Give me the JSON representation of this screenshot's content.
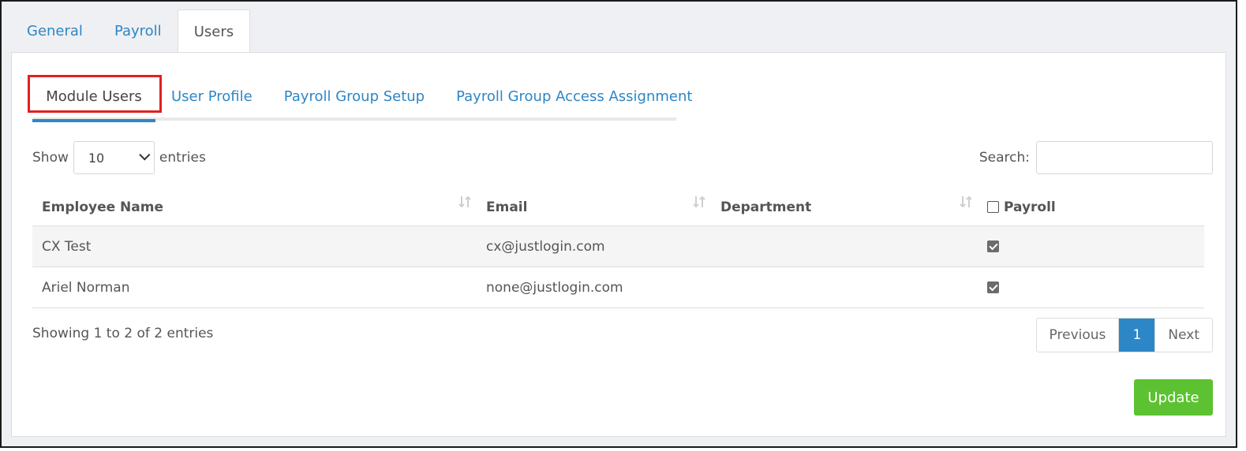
{
  "top_tabs": [
    {
      "label": "General",
      "active": false
    },
    {
      "label": "Payroll",
      "active": false
    },
    {
      "label": "Users",
      "active": true
    }
  ],
  "sub_tabs": [
    {
      "label": "Module Users",
      "active": true,
      "highlighted": true
    },
    {
      "label": "User Profile",
      "active": false
    },
    {
      "label": "Payroll Group Setup",
      "active": false
    },
    {
      "label": "Payroll Group Access Assignment",
      "active": false
    }
  ],
  "length": {
    "show_label": "Show",
    "value": "10",
    "entries_label": "entries"
  },
  "search": {
    "label": "Search:",
    "value": ""
  },
  "table": {
    "columns": [
      "Employee Name",
      "Email",
      "Department",
      "Payroll"
    ],
    "header_payroll_checked": false,
    "rows": [
      {
        "name": "CX Test",
        "email": "cx@justlogin.com",
        "department": "",
        "payroll": true
      },
      {
        "name": "Ariel Norman",
        "email": "none@justlogin.com",
        "department": "",
        "payroll": true
      }
    ]
  },
  "info": "Showing 1 to 2 of 2 entries",
  "pagination": {
    "previous": "Previous",
    "current": "1",
    "next": "Next"
  },
  "update_label": "Update",
  "colors": {
    "link": "#2d86c6",
    "update": "#5cc232",
    "highlight": "#e02020"
  }
}
